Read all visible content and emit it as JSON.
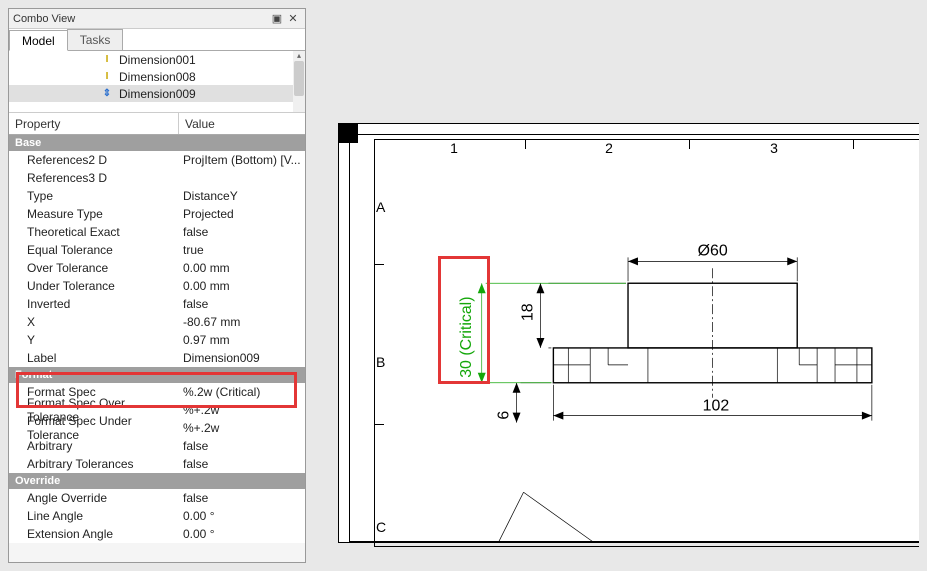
{
  "panel": {
    "title": "Combo View",
    "tabs": [
      "Model",
      "Tasks"
    ],
    "active_tab": "Model",
    "tree_items": [
      {
        "label": "Dimension001",
        "icon": "yellow"
      },
      {
        "label": "Dimension008",
        "icon": "yellow"
      },
      {
        "label": "Dimension009",
        "icon": "blue",
        "selected": true
      },
      {
        "label": "",
        "icon": ""
      }
    ],
    "prop_header": {
      "property": "Property",
      "value": "Value"
    },
    "sections": {
      "base": {
        "title": "Base",
        "rows": [
          {
            "p": "References2 D",
            "v": "ProjItem (Bottom) [V..."
          },
          {
            "p": "References3 D",
            "v": ""
          },
          {
            "p": "Type",
            "v": "DistanceY"
          },
          {
            "p": "Measure Type",
            "v": "Projected"
          },
          {
            "p": "Theoretical Exact",
            "v": "false"
          },
          {
            "p": "Equal Tolerance",
            "v": "true"
          },
          {
            "p": "Over Tolerance",
            "v": "0.00 mm"
          },
          {
            "p": "Under Tolerance",
            "v": "0.00 mm"
          },
          {
            "p": "Inverted",
            "v": "false"
          },
          {
            "p": "X",
            "v": "-80.67 mm"
          },
          {
            "p": "Y",
            "v": "0.97 mm"
          },
          {
            "p": "Label",
            "v": "Dimension009"
          }
        ]
      },
      "format": {
        "title": "Format",
        "rows": [
          {
            "p": "Format Spec",
            "v": "%.2w (Critical)"
          },
          {
            "p": "Format Spec Over Tolerance",
            "v": "%+.2w"
          },
          {
            "p": "Format Spec Under Tolerance",
            "v": "%+.2w"
          },
          {
            "p": "Arbitrary",
            "v": "false"
          },
          {
            "p": "Arbitrary Tolerances",
            "v": "false"
          }
        ]
      },
      "override": {
        "title": "Override",
        "rows": [
          {
            "p": "Angle Override",
            "v": "false"
          },
          {
            "p": "Line Angle",
            "v": "0.00 °"
          },
          {
            "p": "Extension Angle",
            "v": "0.00 °"
          }
        ]
      }
    }
  },
  "drawing": {
    "columns": [
      "1",
      "2",
      "3"
    ],
    "rows": [
      "A",
      "B",
      "C"
    ],
    "dim_phi60": "Ø60",
    "dim_102": "102",
    "dim_18": "18",
    "dim_6": "6",
    "dim_30crit": "30 (Critical)"
  },
  "icons": {
    "undock": "▣",
    "close": "✕"
  }
}
